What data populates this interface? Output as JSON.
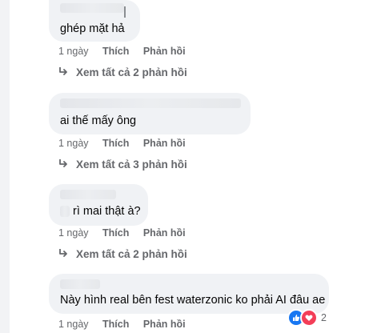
{
  "comments": [
    {
      "text": "ghép mặt hả",
      "time": "1 ngày",
      "like_label": "Thích",
      "reply_label": "Phản hồi",
      "view_replies": "Xem tất cả 2 phản hồi"
    },
    {
      "text": "ai thế mấy ông",
      "time": "1 ngày",
      "like_label": "Thích",
      "reply_label": "Phản hồi",
      "view_replies": "Xem tất cả 3 phản hồi"
    },
    {
      "text": "rì mai thật à?",
      "time": "1 ngày",
      "like_label": "Thích",
      "reply_label": "Phản hồi",
      "view_replies": "Xem tất cả 2 phản hồi"
    },
    {
      "text": "Này hình real bên fest waterzonic ko phải AI đâu ae",
      "time": "1 ngày",
      "like_label": "Thích",
      "reply_label": "Phản hồi",
      "reaction_count": "2",
      "reaction_icons": [
        "like-icon",
        "love-icon"
      ]
    }
  ],
  "colors": {
    "bubble": "#f0f2f5",
    "secondary_text": "#65676b",
    "like_blue": "#1877f2",
    "love_red": "#f33e58"
  }
}
